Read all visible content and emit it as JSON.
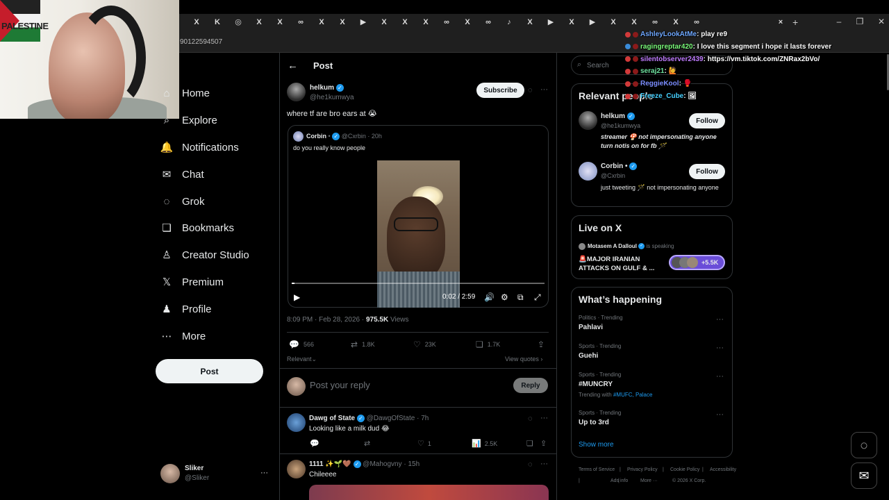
{
  "browser": {
    "url_fragment": "90122594507",
    "tab_glyphs": [
      "X",
      "K",
      "◎",
      "X",
      "X",
      "∞",
      "X",
      "X",
      "▶",
      "X",
      "X",
      "X",
      "∞",
      "X",
      "∞",
      "♪",
      "X",
      "▶",
      "X",
      "▶",
      "X",
      "X",
      "∞",
      "X",
      "∞"
    ],
    "new_tab": "+",
    "close_tab": "×",
    "min": "–",
    "restore": "❐",
    "close": "✕"
  },
  "webcam": {
    "flag_text": "PALESTINE"
  },
  "nav": {
    "items": [
      {
        "label": "Home",
        "icon": "home-icon",
        "glyph": "⌂"
      },
      {
        "label": "Explore",
        "icon": "search-icon",
        "glyph": "⌕"
      },
      {
        "label": "Notifications",
        "icon": "bell-icon",
        "glyph": "🔔"
      },
      {
        "label": "Chat",
        "icon": "mail-icon",
        "glyph": "✉"
      },
      {
        "label": "Grok",
        "icon": "grok-icon",
        "glyph": "◌"
      },
      {
        "label": "Bookmarks",
        "icon": "bookmark-icon",
        "glyph": "❏"
      },
      {
        "label": "Creator Studio",
        "icon": "creator-icon",
        "glyph": "♙"
      },
      {
        "label": "Premium",
        "icon": "x-logo-icon",
        "glyph": "𝕏"
      },
      {
        "label": "Profile",
        "icon": "person-icon",
        "glyph": "♟"
      },
      {
        "label": "More",
        "icon": "more-circle-icon",
        "glyph": "⋯"
      }
    ],
    "post_label": "Post",
    "account_name": "Sliker",
    "account_handle": "@Sliker",
    "account_more": "···"
  },
  "post": {
    "header_title": "Post",
    "author_name": "helkum",
    "author_handle": "@he1kumwya",
    "subscribe_label": "Subscribe",
    "more": "···",
    "text": "where tf are bro ears at 😭",
    "quote": {
      "author_name": "Corbin",
      "author_badge": "•",
      "author_handle": "@Cxrbin",
      "time": "· 20h",
      "text": "do you really know people",
      "video_time": "0:02 / 2:59"
    },
    "timestamp": "8:09 PM · Feb 28, 2026 · ",
    "views_count": "975.5K",
    "views_label": "Views",
    "stats": {
      "replies": "566",
      "reposts": "1.8K",
      "likes": "23K",
      "bookmarks": "1.7K"
    },
    "relevant_label": "Relevant",
    "view_quotes": "View quotes ›",
    "reply_placeholder": "Post your reply",
    "reply_button": "Reply"
  },
  "replies": [
    {
      "name": "Dawg of State",
      "handle": "@DawgOfState",
      "time": "· 7h",
      "text": "Looking like a milk dud 😂",
      "stats": {
        "replies": "",
        "reposts": "",
        "likes": "1",
        "views": "2.5K"
      }
    },
    {
      "name": "1111 ✨🌱🤎",
      "handle": "@Mahogvny",
      "time": "· 15h",
      "text": "Chileeee"
    }
  ],
  "sidebar": {
    "search_placeholder": "Search",
    "relevant_title": "Relevant people",
    "people": [
      {
        "name": "helkum",
        "handle": "@he1kumwya",
        "bio": "streamer 🍄 not impersonating anyone  turn notis on for fb 🪄",
        "follow": "Follow"
      },
      {
        "name": "Corbin •",
        "handle": "@Cxrbin",
        "bio": "just tweeting 🪄 not impersonating anyone",
        "follow": "Follow"
      }
    ],
    "live_title": "Live on X",
    "live_host": "Motasem A Dalloul",
    "live_status": "is speaking",
    "live_text": "🚨MAJOR IRANIAN ATTACKS ON GULF & ...",
    "live_count": "+5.5K",
    "happening_title": "What’s happening",
    "trends": [
      {
        "category": "Politics · Trending",
        "name": "Pahlavi",
        "extra": ""
      },
      {
        "category": "Sports · Trending",
        "name": "Guehi",
        "extra": ""
      },
      {
        "category": "Sports · Trending",
        "name": "#MUNCRY",
        "extra_prefix": "Trending with ",
        "extra": "#MUFC, Palace"
      },
      {
        "category": "Sports · Trending",
        "name": "Up to 3rd",
        "extra": ""
      }
    ],
    "show_more": "Show more",
    "footer": [
      "Terms of Service",
      "|",
      "Privacy Policy",
      "|",
      "Cookie Policy",
      "|",
      "Accessibility",
      "|",
      "Ads info",
      "|",
      "More ···",
      "© 2026 X Corp."
    ]
  },
  "chat": [
    {
      "user": "AshleyLookAtMe",
      "msg": ": play re9",
      "color": "#6fa8ff"
    },
    {
      "user": "ragingreptar420",
      "msg": ": I love this segment i hope it lasts forever",
      "color": "#7cfc7c"
    },
    {
      "user": "silentobserver2439",
      "msg": ": https://vm.tiktok.com/ZNRax2bVo/",
      "color": "#c07cff"
    },
    {
      "user": "seraj21",
      "msg": ": 🙋",
      "color": "#6fe3a0"
    },
    {
      "user": "ReggieKool",
      "msg": ": 🥊",
      "color": "#7a8cff"
    },
    {
      "user": "Freeze_Cube",
      "msg": ": 🖼",
      "color": "#46d0ff"
    }
  ],
  "colors": {
    "accent": "#1d9bf0",
    "bg": "#000000",
    "border": "#2f3336",
    "muted": "#71767b"
  }
}
